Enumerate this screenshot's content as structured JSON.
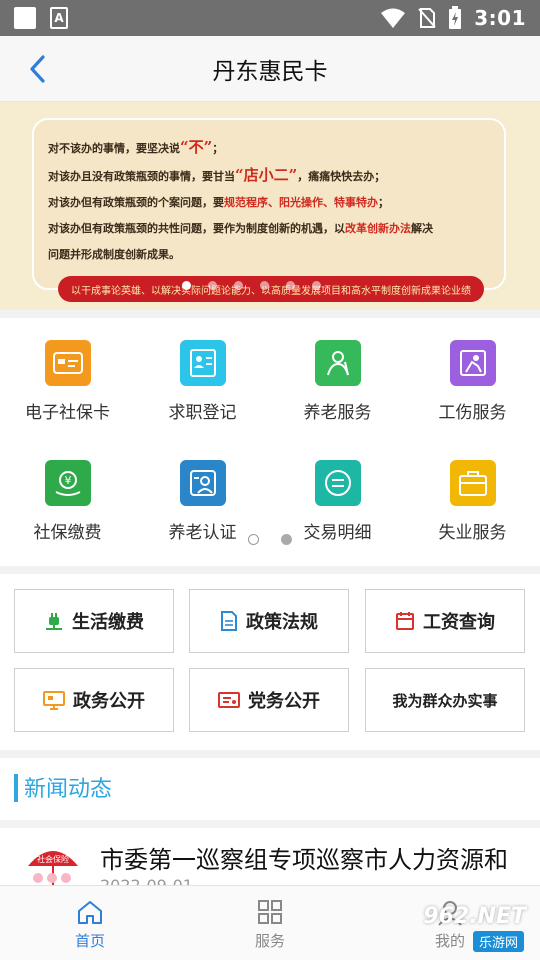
{
  "status_bar": {
    "time": "3:01"
  },
  "nav": {
    "title": "丹东惠民卡"
  },
  "banner": {
    "lines": [
      {
        "a": "对不该办的事情，要坚决说",
        "b": "“不”",
        "c": "；"
      },
      {
        "a": "对该办且没有政策瓶颈的事情，要甘当",
        "b": "“店小二”",
        "c": "，痛痛快快去办；"
      },
      {
        "a": "对该办但有政策瓶颈的个案问题，要",
        "b": "规范程序、阳光操作、特事特办",
        "c": "；"
      },
      {
        "a": "对该办但有政策瓶颈的共性问题，要作为制度创新的机遇，以",
        "b": "改革创新办法",
        "c": "解决"
      },
      {
        "a": "问题并形成制度创新成果。",
        "b": "",
        "c": ""
      }
    ],
    "ribbon": "以干成事论英雄、以解决实际问题论能力、以高质量发展项目和高水平制度创新成果论业绩",
    "dots": 6,
    "active_dot": 0
  },
  "services": [
    {
      "label": "电子社保卡",
      "icon": "card-icon",
      "color": "#f39a1e"
    },
    {
      "label": "求职登记",
      "icon": "id-card-icon",
      "color": "#2cc4e8"
    },
    {
      "label": "养老服务",
      "icon": "elderly-icon",
      "color": "#35b95a"
    },
    {
      "label": "工伤服务",
      "icon": "injury-icon",
      "color": "#9b5fe0"
    },
    {
      "label": "社保缴费",
      "icon": "payment-icon",
      "color": "#2faa4a"
    },
    {
      "label": "养老认证",
      "icon": "face-verify-icon",
      "color": "#2b86c9"
    },
    {
      "label": "交易明细",
      "icon": "transaction-icon",
      "color": "#1eb7a6"
    },
    {
      "label": "失业服务",
      "icon": "briefcase-icon",
      "color": "#f2b705"
    }
  ],
  "quick_buttons": [
    {
      "label": "生活缴费",
      "icon": "plug-icon",
      "color": "#2faa4a"
    },
    {
      "label": "政策法规",
      "icon": "document-icon",
      "color": "#2c8bd6"
    },
    {
      "label": "工资查询",
      "icon": "calendar-icon",
      "color": "#d9342b"
    },
    {
      "label": "政务公开",
      "icon": "monitor-icon",
      "color": "#f39a1e"
    },
    {
      "label": "党务公开",
      "icon": "ticket-icon",
      "color": "#d9342b"
    },
    {
      "label": "我为群众办实事",
      "icon": "",
      "color": ""
    }
  ],
  "news": {
    "section_title": "新闻动态",
    "items": [
      {
        "title": "市委第一巡察组专项巡察市人力资源和",
        "date": "2022-09-01",
        "thumb_label": "社会保险"
      }
    ]
  },
  "tabs": [
    {
      "label": "首页",
      "icon": "home-icon",
      "active": true
    },
    {
      "label": "服务",
      "icon": "grid-icon",
      "active": false
    },
    {
      "label": "我的",
      "icon": "user-icon",
      "active": false
    }
  ],
  "watermark": {
    "text": "962.NET",
    "sub": "乐游网"
  },
  "colors": {
    "accent": "#2f7fd6",
    "news_accent": "#2ea6e0",
    "banner_red": "#c81e24"
  }
}
